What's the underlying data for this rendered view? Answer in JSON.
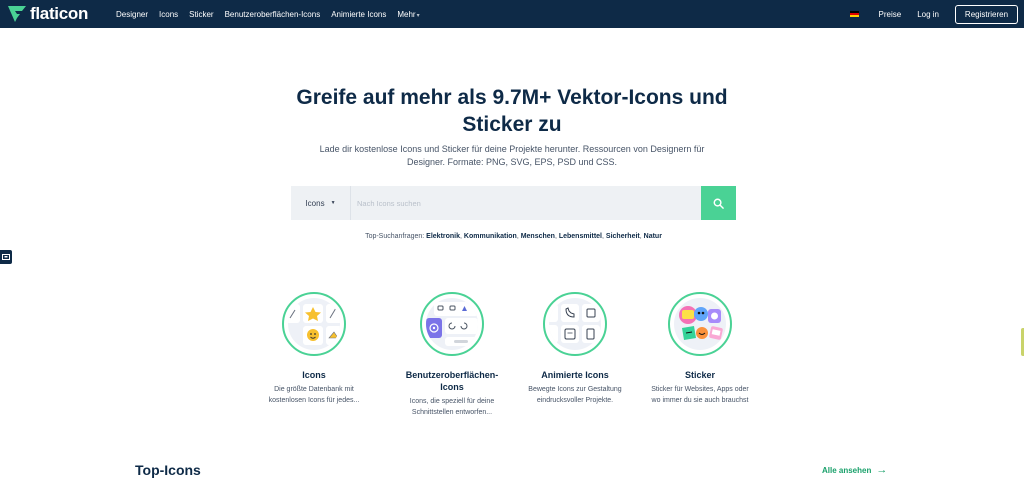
{
  "nav": {
    "logo_text": "flaticon",
    "links": [
      "Designer",
      "Icons",
      "Sticker",
      "Benutzeroberflächen-Icons",
      "Animierte Icons",
      "Mehr"
    ],
    "pricing": "Preise",
    "login": "Log in",
    "register": "Registrieren"
  },
  "hero": {
    "title_line1": "Greife auf mehr als 9.7M+ Vektor-Icons und",
    "title_line2": "Sticker zu",
    "subtitle_line1": "Lade dir kostenlose Icons und Sticker für deine Projekte herunter. Ressourcen von Designern für",
    "subtitle_line2": "Designer. Formate: PNG, SVG, EPS, PSD und CSS."
  },
  "search": {
    "type_label": "Icons",
    "placeholder": "Nach Icons suchen"
  },
  "top_searches": {
    "label": "Top-Suchanfragen:",
    "terms": [
      "Elektronik",
      "Kommunikation",
      "Menschen",
      "Lebensmittel",
      "Sicherheit",
      "Natur"
    ]
  },
  "cards": [
    {
      "title": "Icons",
      "desc_line1": "Die größte Datenbank mit",
      "desc_line2": "kostenlosen Icons für jedes..."
    },
    {
      "title_line1": "Benutzeroberflächen-",
      "title_line2": "Icons",
      "desc_line1": "Icons, die speziell für deine",
      "desc_line2": "Schnittstellen entworfen..."
    },
    {
      "title": "Animierte Icons",
      "desc_line1": "Bewegte Icons zur Gestaltung",
      "desc_line2": "eindrucksvoller Projekte."
    },
    {
      "title": "Sticker",
      "desc_line1": "Sticker für Websites, Apps oder",
      "desc_line2": "wo immer du sie auch brauchst"
    }
  ],
  "top_icons": {
    "title": "Top-Icons",
    "see_all": "Alle ansehen"
  },
  "colors": {
    "nav_bg": "#0e2a47",
    "accent": "#4ad295",
    "link_green": "#18a06a"
  }
}
